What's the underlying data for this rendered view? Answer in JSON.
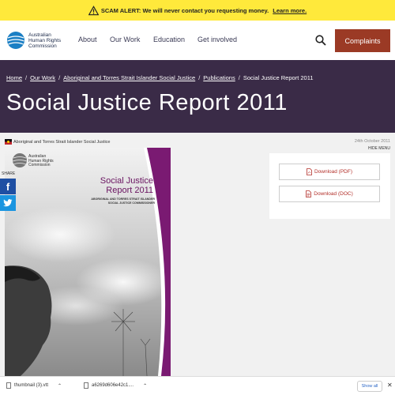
{
  "alert": {
    "text": "SCAM ALERT: We will never contact you requesting money.",
    "link": "Learn more."
  },
  "header": {
    "logo_lines": [
      "Australian",
      "Human Rights",
      "Commission"
    ],
    "nav": [
      "About",
      "Our Work",
      "Education",
      "Get involved"
    ],
    "complaints_label": "Complaints"
  },
  "breadcrumb": {
    "home": "Home",
    "our_work": "Our Work",
    "social_justice": "Aboriginal and Torres Strait Islander Social Justice",
    "publications": "Publications",
    "current": "Social Justice Report 2011"
  },
  "page_title": "Social Justice Report 2011",
  "meta": {
    "category": "Aboriginal and Torres Strait Islander Social Justice",
    "date": "24th October 2011",
    "hide_menu": "HIDE MENU",
    "share": "SHARE"
  },
  "cover": {
    "org_lines": [
      "Australian",
      "Human Rights",
      "Commission"
    ],
    "title_lines": [
      "Social Justice",
      "Report 2011"
    ],
    "subtitle_lines": [
      "ABORIGINAL AND TORRES STRAIT ISLANDER",
      "SOCIAL JUSTICE COMMISSIONER"
    ]
  },
  "downloads": {
    "pdf_label": "Download (PDF)",
    "doc_label": "Download (DOC)"
  },
  "download_bar": {
    "item1": "thumbnail (3).vtt",
    "item2": "a6269d606e42c1....",
    "show_all": "Show all"
  },
  "colors": {
    "alert_bg": "#ffe93b",
    "hero_bg": "#3a2b47",
    "complaints_bg": "#9b3a25",
    "cover_accent": "#6a1461"
  }
}
